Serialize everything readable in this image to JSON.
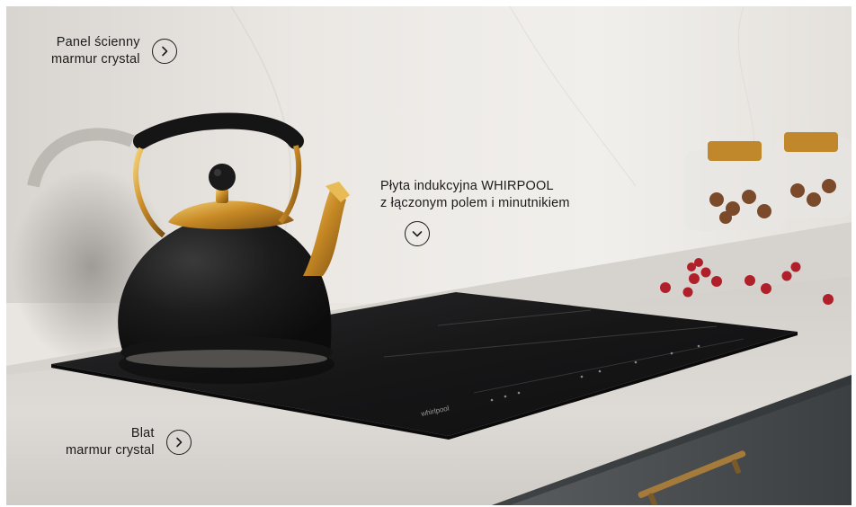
{
  "colors": {
    "wall": "#e7e4df",
    "countertop": "#d9d5d0",
    "cabinet": "#4a4d4e",
    "cooktop": "#1b1b1c",
    "kettle_black": "#1a1a1a",
    "kettle_gold": "#c9932a",
    "cranberry": "#b0202a",
    "hotspot_text": "#1b1b1b"
  },
  "hotspots": [
    {
      "id": "wall-panel",
      "lines": [
        "Panel ścienny",
        "marmur crystal"
      ],
      "icon": "chevron-right-icon"
    },
    {
      "id": "cooktop",
      "lines": [
        "Płyta indukcyjna WHIRPOOL",
        "z łączonym polem i minutnikiem"
      ],
      "icon": "chevron-down-icon"
    },
    {
      "id": "countertop",
      "lines": [
        "Blat",
        "marmur crystal"
      ],
      "icon": "chevron-right-icon"
    }
  ],
  "cooktop_brand": "whirlpool"
}
